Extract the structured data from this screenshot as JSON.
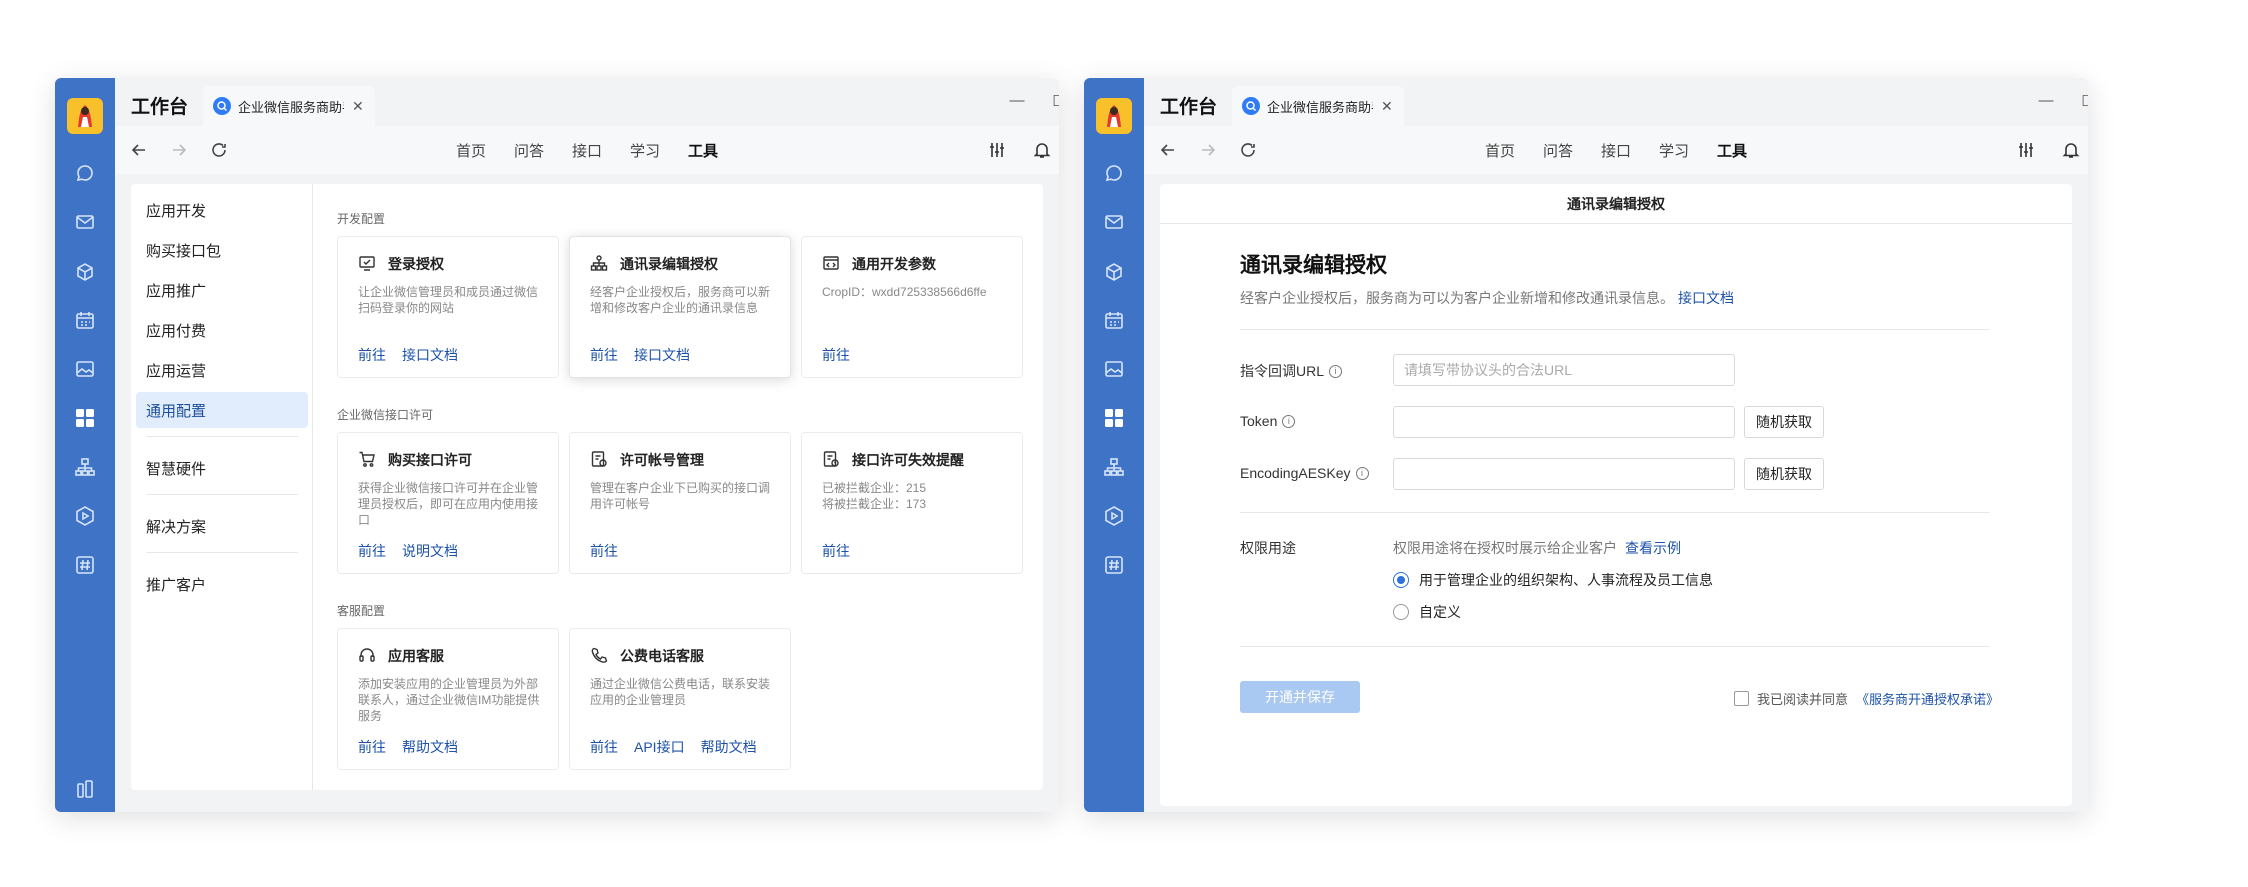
{
  "app": {
    "title": "工作台",
    "tab_label": "企业微信服务商助手",
    "colors": {
      "rail": "#3e73c5",
      "link": "#1d52a9",
      "selected": "#e1ecfd",
      "primary_disabled": "#a9c8f2"
    }
  },
  "nav": {
    "items": [
      "首页",
      "问答",
      "接口",
      "学习",
      "工具"
    ],
    "active": "工具"
  },
  "rail_icons": [
    "chat-icon",
    "mail-icon",
    "docs-icon",
    "calendar-icon",
    "image-icon",
    "workbench-icon",
    "org-icon",
    "video-icon",
    "channel-icon",
    "phone-icon"
  ],
  "sidebar": {
    "items": [
      {
        "label": "应用开发"
      },
      {
        "label": "购买接口包"
      },
      {
        "label": "应用推广"
      },
      {
        "label": "应用付费"
      },
      {
        "label": "应用运营"
      },
      {
        "label": "通用配置"
      },
      {
        "label": "智慧硬件"
      },
      {
        "label": "解决方案"
      },
      {
        "label": "推广客户"
      }
    ],
    "selected": "通用配置"
  },
  "sections": [
    {
      "title": "开发配置",
      "cards": [
        {
          "icon": "monitor-check-icon",
          "title": "登录授权",
          "desc": "让企业微信管理员和成员通过微信扫码登录你的网站",
          "links": [
            "前往",
            "接口文档"
          ]
        },
        {
          "icon": "contacts-org-icon",
          "title": "通讯录编辑授权",
          "desc": "经客户企业授权后，服务商可以新增和修改客户企业的通讯录信息",
          "links": [
            "前往",
            "接口文档"
          ]
        },
        {
          "icon": "code-window-icon",
          "title": "通用开发参数",
          "desc": "CropID：wxdd725338566d6ffe",
          "links": [
            "前往"
          ]
        }
      ]
    },
    {
      "title": "企业微信接口许可",
      "cards": [
        {
          "icon": "cart-icon",
          "title": "购买接口许可",
          "desc": "获得企业微信接口许可并在企业管理员授权后，即可在应用内使用接口",
          "links": [
            "前往",
            "说明文档"
          ]
        },
        {
          "icon": "license-icon",
          "title": "许可帐号管理",
          "desc": "管理在客户企业下已购买的接口调用许可帐号",
          "links": [
            "前往"
          ]
        },
        {
          "icon": "license-alert-icon",
          "title": "接口许可失效提醒",
          "desc": "已被拦截企业：215\n将被拦截企业：173",
          "links": [
            "前往"
          ]
        }
      ]
    },
    {
      "title": "客服配置",
      "cards": [
        {
          "icon": "headset-icon",
          "title": "应用客服",
          "desc": "添加安装应用的企业管理员为外部联系人，通过企业微信IM功能提供服务",
          "links": [
            "前往",
            "帮助文档"
          ]
        },
        {
          "icon": "telephone-icon",
          "title": "公费电话客服",
          "desc": "通过企业微信公费电话，联系安装应用的企业管理员",
          "links": [
            "前往",
            "API接口",
            "帮助文档"
          ]
        }
      ]
    }
  ],
  "form": {
    "header": "通讯录编辑授权",
    "title": "通讯录编辑授权",
    "desc": "经客户企业授权后，服务商为可以为客户企业新增和修改通讯录信息。",
    "desc_link": "接口文档",
    "callback_label": "指令回调URL",
    "callback_placeholder": "请填写带协议头的合法URL",
    "callback_value": "",
    "token_label": "Token",
    "token_value": "",
    "aeskey_label": "EncodingAESKey",
    "aeskey_value": "",
    "random_btn": "随机获取",
    "purpose_label": "权限用途",
    "purpose_hint": "权限用途将在授权时展示给企业客户",
    "purpose_link": "查看示例",
    "options": [
      {
        "label": "用于管理企业的组织架构、人事流程及员工信息",
        "checked": true
      },
      {
        "label": "自定义",
        "checked": false
      }
    ],
    "save_btn": "开通并保存",
    "agree_text": "我已阅读并同意",
    "agree_link": "《服务商开通授权承诺》"
  }
}
